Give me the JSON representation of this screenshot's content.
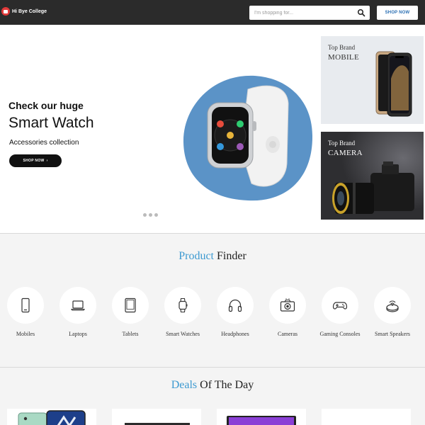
{
  "header": {
    "brand": "Hi Bye College",
    "search_placeholder": "I'm shopping for...",
    "shop_now": "SHOP NOW"
  },
  "hero": {
    "heading": "Check our huge",
    "title": "Smart Watch",
    "subtitle": "Accessories collection",
    "button": "SHOP NOW",
    "slides": 3
  },
  "brands": [
    {
      "top": "Top Brand",
      "name": "MOBILE"
    },
    {
      "top": "Top Brand",
      "name": "CAMERA"
    }
  ],
  "finder": {
    "title_accent": "Product",
    "title_rest": "Finder",
    "categories": [
      {
        "label": "Mobiles",
        "icon": "mobile-icon"
      },
      {
        "label": "Laptops",
        "icon": "laptop-icon"
      },
      {
        "label": "Tablets",
        "icon": "tablet-icon"
      },
      {
        "label": "Smart Watches",
        "icon": "smartwatch-icon"
      },
      {
        "label": "Headphones",
        "icon": "headphones-icon"
      },
      {
        "label": "Cameras",
        "icon": "camera-icon"
      },
      {
        "label": "Gaming Consoles",
        "icon": "gamepad-icon"
      },
      {
        "label": "Smart Speakers",
        "icon": "speaker-icon"
      }
    ]
  },
  "deals": {
    "title_accent": "Deals",
    "title_rest": "Of The Day"
  },
  "colors": {
    "header_bg": "#2b2b2b",
    "accent": "#3d9ad1",
    "button_text": "#2a6fb3",
    "logo": "#e23a3a",
    "hero_blob": "#5b93c7"
  }
}
